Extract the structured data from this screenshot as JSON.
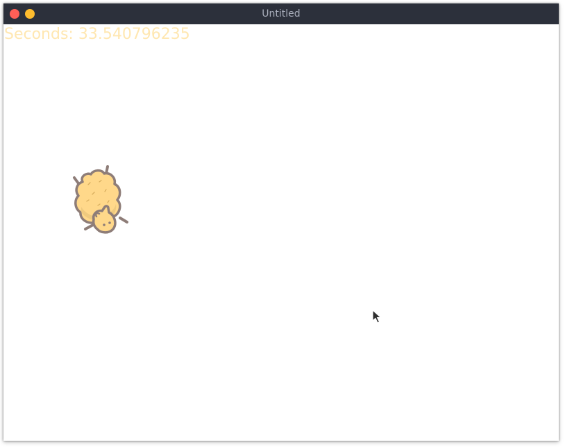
{
  "window": {
    "title": "Untitled",
    "controls": {
      "close_color": "#ff5f57",
      "minimize_color": "#febc2e"
    }
  },
  "game": {
    "timer_text": "Seconds: 33.540796235",
    "timer_color": "#ffe7b1",
    "sprite": "sheep",
    "sprite_colors": {
      "wool": "#ffd88a",
      "wool_shade": "#e8c47a",
      "outline": "#8e7d78"
    }
  },
  "cursor": {
    "icon": "arrow-pointer-icon"
  }
}
